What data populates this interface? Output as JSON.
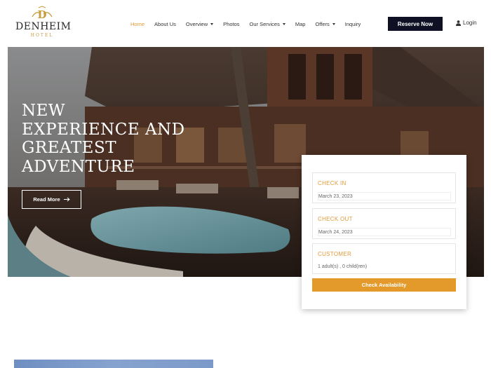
{
  "brand": {
    "name": "DENHEIM",
    "subtitle": "HOTEL",
    "gold": "#c79a3c"
  },
  "nav": {
    "items": [
      {
        "label": "Home",
        "active": true,
        "dropdown": false
      },
      {
        "label": "About Us",
        "active": false,
        "dropdown": false
      },
      {
        "label": "Overview",
        "active": false,
        "dropdown": true
      },
      {
        "label": "Photos",
        "active": false,
        "dropdown": false
      },
      {
        "label": "Our Services",
        "active": false,
        "dropdown": true
      },
      {
        "label": "Map",
        "active": false,
        "dropdown": false
      },
      {
        "label": "Offers",
        "active": false,
        "dropdown": true
      },
      {
        "label": "Inquiry",
        "active": false,
        "dropdown": false
      }
    ],
    "reserve_label": "Reserve Now",
    "login_label": "Login",
    "icons": {
      "login": "user-icon",
      "dropdown": "caret-down-icon"
    }
  },
  "hero": {
    "title_lines": [
      "NEW",
      "EXPERIENCE AND",
      "GREATEST",
      "ADVENTURE"
    ],
    "read_more_label": "Read More",
    "read_more_icon": "arrow-right-icon"
  },
  "booking": {
    "check_in": {
      "label": "CHECK IN",
      "value": "March 23, 2023"
    },
    "check_out": {
      "label": "CHECK OUT",
      "value": "March 24, 2023"
    },
    "customer": {
      "label": "CUSTOMER",
      "value": "1 adult(s) , 0 child(ren)"
    },
    "button_label": "Check Availability",
    "accent": "#e39a2a"
  },
  "colors": {
    "accent": "#e09a3a",
    "dark_button": "#0f1024"
  }
}
